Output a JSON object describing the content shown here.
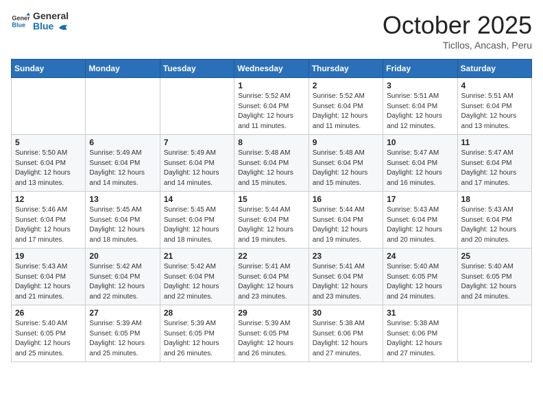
{
  "header": {
    "logo_general": "General",
    "logo_blue": "Blue",
    "month": "October 2025",
    "location": "Ticllos, Ancash, Peru"
  },
  "weekdays": [
    "Sunday",
    "Monday",
    "Tuesday",
    "Wednesday",
    "Thursday",
    "Friday",
    "Saturday"
  ],
  "weeks": [
    [
      {
        "day": "",
        "info": ""
      },
      {
        "day": "",
        "info": ""
      },
      {
        "day": "",
        "info": ""
      },
      {
        "day": "1",
        "info": "Sunrise: 5:52 AM\nSunset: 6:04 PM\nDaylight: 12 hours\nand 11 minutes."
      },
      {
        "day": "2",
        "info": "Sunrise: 5:52 AM\nSunset: 6:04 PM\nDaylight: 12 hours\nand 11 minutes."
      },
      {
        "day": "3",
        "info": "Sunrise: 5:51 AM\nSunset: 6:04 PM\nDaylight: 12 hours\nand 12 minutes."
      },
      {
        "day": "4",
        "info": "Sunrise: 5:51 AM\nSunset: 6:04 PM\nDaylight: 12 hours\nand 13 minutes."
      }
    ],
    [
      {
        "day": "5",
        "info": "Sunrise: 5:50 AM\nSunset: 6:04 PM\nDaylight: 12 hours\nand 13 minutes."
      },
      {
        "day": "6",
        "info": "Sunrise: 5:49 AM\nSunset: 6:04 PM\nDaylight: 12 hours\nand 14 minutes."
      },
      {
        "day": "7",
        "info": "Sunrise: 5:49 AM\nSunset: 6:04 PM\nDaylight: 12 hours\nand 14 minutes."
      },
      {
        "day": "8",
        "info": "Sunrise: 5:48 AM\nSunset: 6:04 PM\nDaylight: 12 hours\nand 15 minutes."
      },
      {
        "day": "9",
        "info": "Sunrise: 5:48 AM\nSunset: 6:04 PM\nDaylight: 12 hours\nand 15 minutes."
      },
      {
        "day": "10",
        "info": "Sunrise: 5:47 AM\nSunset: 6:04 PM\nDaylight: 12 hours\nand 16 minutes."
      },
      {
        "day": "11",
        "info": "Sunrise: 5:47 AM\nSunset: 6:04 PM\nDaylight: 12 hours\nand 17 minutes."
      }
    ],
    [
      {
        "day": "12",
        "info": "Sunrise: 5:46 AM\nSunset: 6:04 PM\nDaylight: 12 hours\nand 17 minutes."
      },
      {
        "day": "13",
        "info": "Sunrise: 5:45 AM\nSunset: 6:04 PM\nDaylight: 12 hours\nand 18 minutes."
      },
      {
        "day": "14",
        "info": "Sunrise: 5:45 AM\nSunset: 6:04 PM\nDaylight: 12 hours\nand 18 minutes."
      },
      {
        "day": "15",
        "info": "Sunrise: 5:44 AM\nSunset: 6:04 PM\nDaylight: 12 hours\nand 19 minutes."
      },
      {
        "day": "16",
        "info": "Sunrise: 5:44 AM\nSunset: 6:04 PM\nDaylight: 12 hours\nand 19 minutes."
      },
      {
        "day": "17",
        "info": "Sunrise: 5:43 AM\nSunset: 6:04 PM\nDaylight: 12 hours\nand 20 minutes."
      },
      {
        "day": "18",
        "info": "Sunrise: 5:43 AM\nSunset: 6:04 PM\nDaylight: 12 hours\nand 20 minutes."
      }
    ],
    [
      {
        "day": "19",
        "info": "Sunrise: 5:43 AM\nSunset: 6:04 PM\nDaylight: 12 hours\nand 21 minutes."
      },
      {
        "day": "20",
        "info": "Sunrise: 5:42 AM\nSunset: 6:04 PM\nDaylight: 12 hours\nand 22 minutes."
      },
      {
        "day": "21",
        "info": "Sunrise: 5:42 AM\nSunset: 6:04 PM\nDaylight: 12 hours\nand 22 minutes."
      },
      {
        "day": "22",
        "info": "Sunrise: 5:41 AM\nSunset: 6:04 PM\nDaylight: 12 hours\nand 23 minutes."
      },
      {
        "day": "23",
        "info": "Sunrise: 5:41 AM\nSunset: 6:04 PM\nDaylight: 12 hours\nand 23 minutes."
      },
      {
        "day": "24",
        "info": "Sunrise: 5:40 AM\nSunset: 6:05 PM\nDaylight: 12 hours\nand 24 minutes."
      },
      {
        "day": "25",
        "info": "Sunrise: 5:40 AM\nSunset: 6:05 PM\nDaylight: 12 hours\nand 24 minutes."
      }
    ],
    [
      {
        "day": "26",
        "info": "Sunrise: 5:40 AM\nSunset: 6:05 PM\nDaylight: 12 hours\nand 25 minutes."
      },
      {
        "day": "27",
        "info": "Sunrise: 5:39 AM\nSunset: 6:05 PM\nDaylight: 12 hours\nand 25 minutes."
      },
      {
        "day": "28",
        "info": "Sunrise: 5:39 AM\nSunset: 6:05 PM\nDaylight: 12 hours\nand 26 minutes."
      },
      {
        "day": "29",
        "info": "Sunrise: 5:39 AM\nSunset: 6:05 PM\nDaylight: 12 hours\nand 26 minutes."
      },
      {
        "day": "30",
        "info": "Sunrise: 5:38 AM\nSunset: 6:06 PM\nDaylight: 12 hours\nand 27 minutes."
      },
      {
        "day": "31",
        "info": "Sunrise: 5:38 AM\nSunset: 6:06 PM\nDaylight: 12 hours\nand 27 minutes."
      },
      {
        "day": "",
        "info": ""
      }
    ]
  ]
}
